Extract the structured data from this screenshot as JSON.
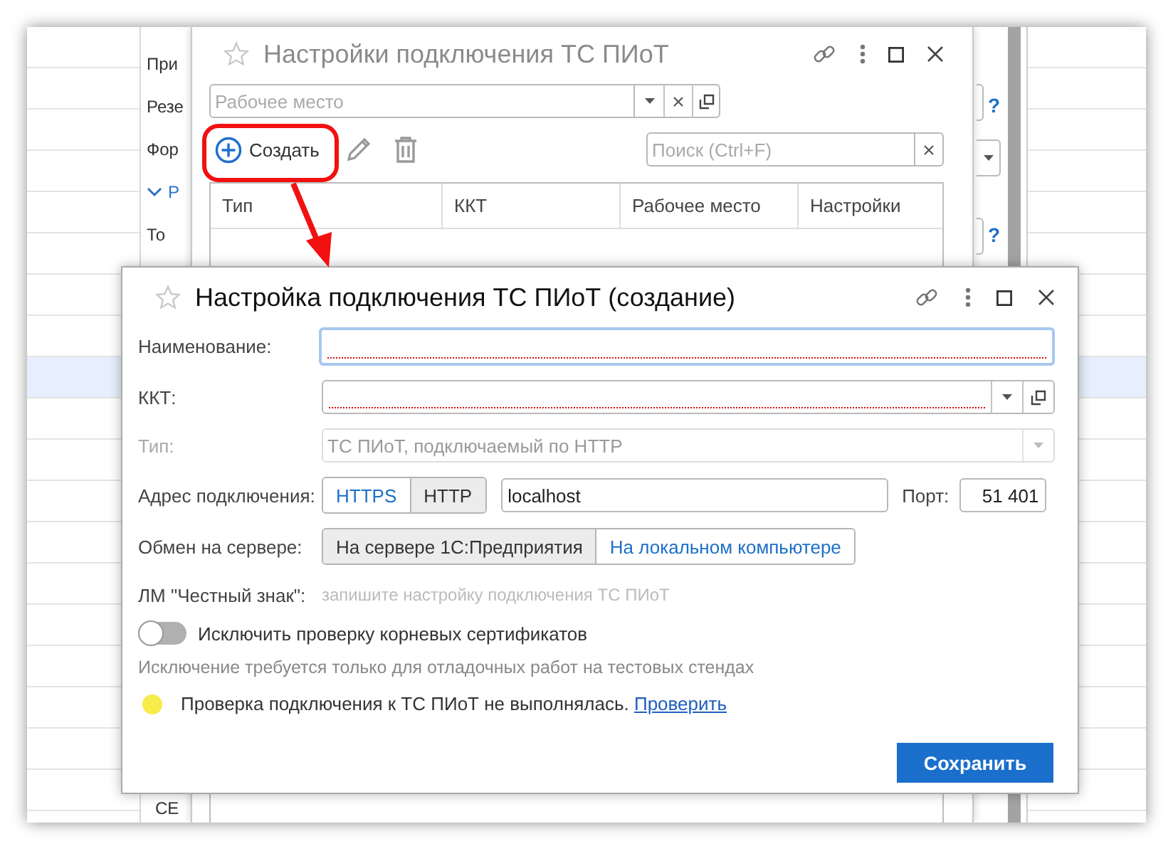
{
  "background_list": {
    "rows": [
      {
        "selected": false
      },
      {
        "selected": false
      },
      {
        "selected": false
      },
      {
        "selected": false
      },
      {
        "selected": false
      },
      {
        "selected": false
      },
      {
        "selected": false
      },
      {
        "selected": false
      },
      {
        "selected": true
      },
      {
        "selected": false
      },
      {
        "selected": false
      },
      {
        "selected": false
      },
      {
        "selected": false
      },
      {
        "selected": false
      },
      {
        "selected": false
      },
      {
        "selected": false
      },
      {
        "selected": false
      },
      {
        "selected": false
      },
      {
        "selected": false
      }
    ]
  },
  "background_form": {
    "items": [
      {
        "kind": "label",
        "text": "При"
      },
      {
        "kind": "label",
        "text": "Резе"
      },
      {
        "kind": "label",
        "text": "Фор"
      },
      {
        "kind": "group",
        "text": "Р",
        "expanded": true
      },
      {
        "kind": "label",
        "text": "То"
      }
    ],
    "footer_label": "СЕ",
    "help_marks": [
      "?",
      "?"
    ]
  },
  "list_window": {
    "title": "Настройки подключения ТС ПИоТ",
    "workplace_field": {
      "placeholder": "Рабочее место"
    },
    "create_button": "Создать",
    "search": {
      "placeholder": "Поиск (Ctrl+F)"
    },
    "table": {
      "columns": [
        "Тип",
        "ККТ",
        "Рабочее место",
        "Настройки"
      ]
    }
  },
  "dialog": {
    "title": "Настройка подключения ТС ПИоТ (создание)",
    "name_field": {
      "label": "Наименование:",
      "focused": true,
      "required": true
    },
    "kkt_field": {
      "label": "ККТ:",
      "required": true
    },
    "type_field": {
      "label": "Тип:",
      "value": "ТС ПИоТ, подключаемый по HTTP",
      "disabled": true
    },
    "address": {
      "label": "Адрес подключения:",
      "protocols": [
        {
          "label": "HTTPS",
          "selected": false
        },
        {
          "label": "HTTP",
          "selected": true
        }
      ],
      "host": "localhost",
      "port_label": "Порт:",
      "port": "51 401"
    },
    "exchange": {
      "label": "Обмен на сервере:",
      "options": [
        {
          "label": "На сервере 1С:Предприятия",
          "selected": true
        },
        {
          "label": "На локальном компьютере",
          "selected": false
        }
      ]
    },
    "marking": {
      "label": "ЛМ \"Честный знак\":",
      "hint": "запишите настройку подключения ТС ПИоТ"
    },
    "skip_cert_check": {
      "label": "Исключить проверку корневых сертификатов",
      "on": false
    },
    "note": "Исключение требуется только для отладочных работ на тестовых стендах",
    "status": {
      "color": "#f7ec4a",
      "text": "Проверка подключения к ТС ПИоТ не выполнялась.",
      "link": "Проверить"
    },
    "save_button": "Сохранить"
  }
}
